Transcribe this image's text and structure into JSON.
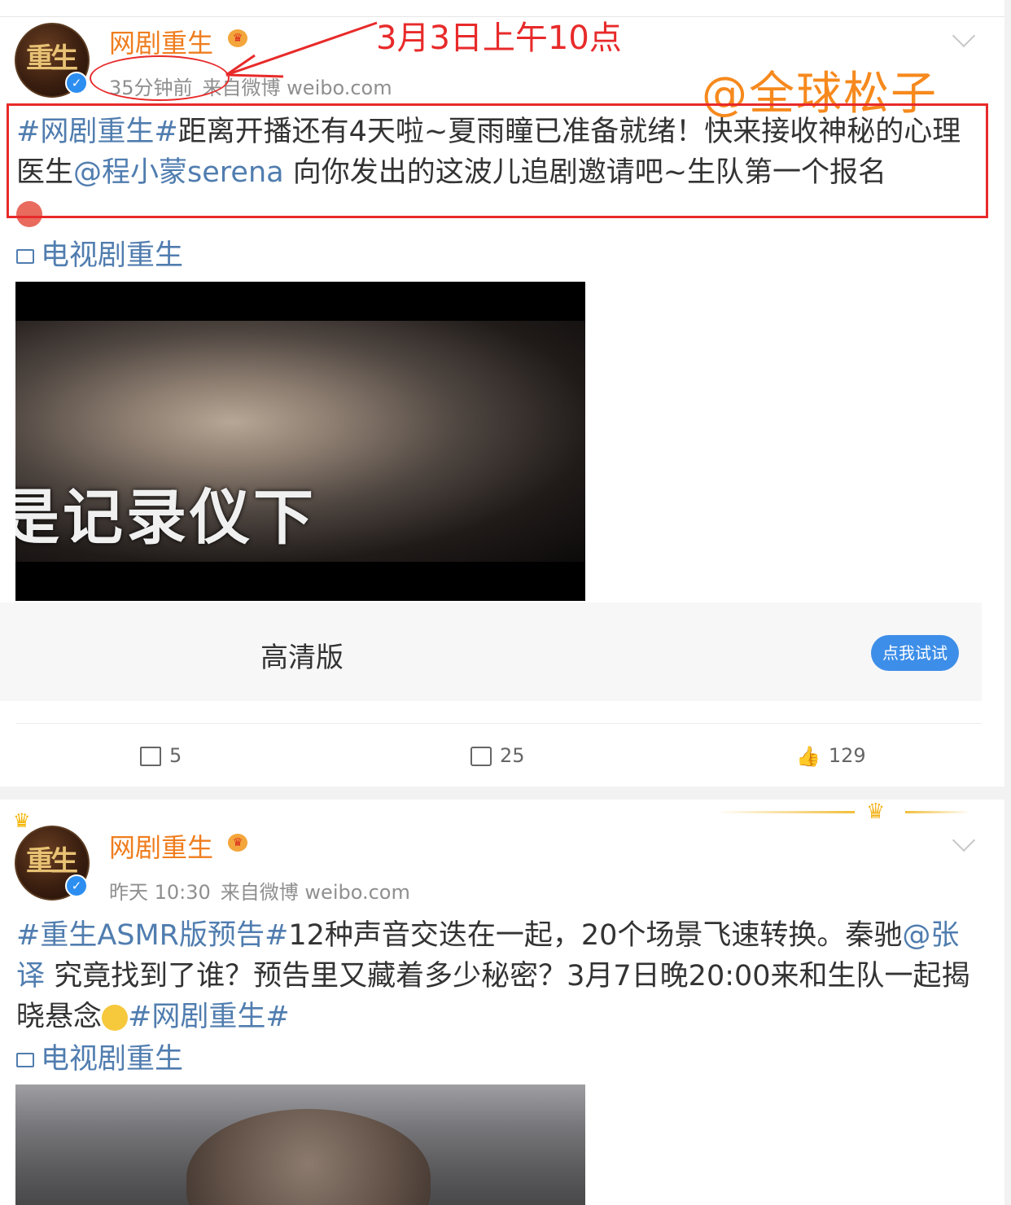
{
  "post1": {
    "username": "网剧重生",
    "time": "35分钟前",
    "source": "来自微博 weibo.com",
    "text_parts": {
      "tag": "#网剧重生#",
      "part1": "距离开播还有4天啦~夏雨瞳已准备就绪！快来接收神秘的心理医生",
      "mention": "@程小蒙serena",
      "part2": " 向你发出的这波儿追剧邀请吧~生队第一个报名"
    },
    "topic_link": "电视剧重生",
    "video_caption": "是记录仪下",
    "hd_label": "高清版",
    "try_button": "点我试试",
    "actions": {
      "repost": "5",
      "comment": "25",
      "like": "129"
    }
  },
  "post2": {
    "username": "网剧重生",
    "time": "昨天 10:30",
    "source": "来自微博 weibo.com",
    "text_parts": {
      "tag1": "#重生ASMR版预告#",
      "part1": "12种声音交迭在一起，20个场景飞速转换。秦驰",
      "mention": "@张译",
      "part2": " 究竟找到了谁？预告里又藏着多少秘密？3月7日晚20:00来和生队一起揭晓悬念",
      "tag2": "#网剧重生#"
    },
    "topic_link": "电视剧重生"
  },
  "annotations": {
    "time_note": "3月3日上午10点",
    "watermark": "@全球松子"
  },
  "colors": {
    "username": "#ef7d1e",
    "link": "#507daf",
    "annotation_red": "#e82a2a",
    "watermark_orange": "#f6891d",
    "button_blue": "#3d8ee8"
  },
  "icons": [
    "verified-icon",
    "vip-crown-icon",
    "chevron-down-icon",
    "video-icon",
    "repost-icon",
    "comment-icon",
    "like-icon"
  ]
}
